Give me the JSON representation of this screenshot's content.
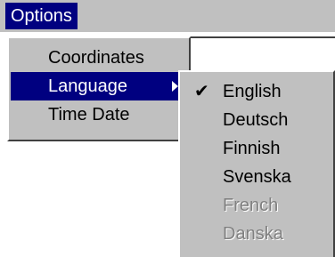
{
  "menubar": {
    "options_label": "Options"
  },
  "options_menu": {
    "items": [
      {
        "label": "Coordinates"
      },
      {
        "label": "Language",
        "selected": true,
        "has_submenu": true
      },
      {
        "label": "Time Date"
      }
    ]
  },
  "language_menu": {
    "items": [
      {
        "label": "English",
        "checked": true,
        "enabled": true
      },
      {
        "label": "Deutsch",
        "enabled": true
      },
      {
        "label": "Finnish",
        "enabled": true
      },
      {
        "label": "Svenska",
        "enabled": true
      },
      {
        "label": "French",
        "enabled": false
      },
      {
        "label": "Danska",
        "enabled": false
      }
    ],
    "check_mark": "✔"
  },
  "colors": {
    "highlight": "#000080",
    "face": "#c0c0c0",
    "disabled_text": "#808080"
  }
}
